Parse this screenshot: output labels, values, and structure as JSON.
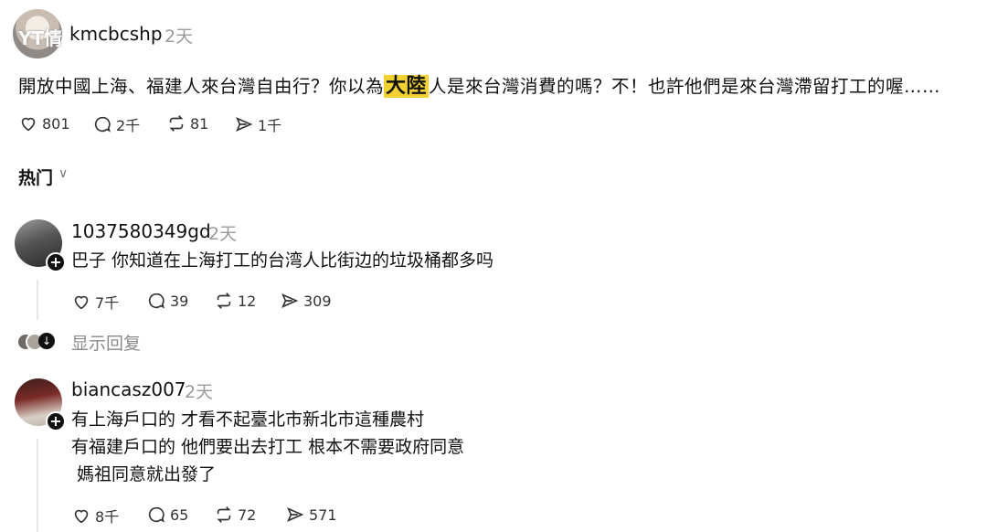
{
  "post": {
    "avatar_watermark": "YT情",
    "username": "kmcbcshp",
    "time": "2天",
    "text_before": "開放中國上海、福建人來台灣自由行？你以為",
    "text_highlight": "大陸",
    "text_after": "人是來台灣消費的嗎？不！也許他們是來台灣滯留打工的喔……",
    "actions": {
      "like": "801",
      "comment": "2千",
      "repost": "81",
      "share": "1千"
    }
  },
  "section": {
    "title": "热门",
    "chevron": "∨"
  },
  "comments": [
    {
      "username": "1037580349gd",
      "time": "2天",
      "lines": [
        "巴子 你知道在上海打工的台湾人比街边的垃圾桶都多吗"
      ],
      "actions": {
        "like": "7千",
        "comment": "39",
        "repost": "12",
        "share": "309"
      },
      "show_replies": "显示回复"
    },
    {
      "username": "biancasz007",
      "time": "2天",
      "lines": [
        "有上海戶口的 才看不起臺北市新北市這種農村",
        "有福建戶口的 他們要出去打工 根本不需要政府同意",
        " 媽祖同意就出發了"
      ],
      "actions": {
        "like": "8千",
        "comment": "65",
        "repost": "72",
        "share": "571"
      }
    }
  ],
  "colors": {
    "highlight": "#f2d232",
    "muted": "#9a9a9a"
  }
}
